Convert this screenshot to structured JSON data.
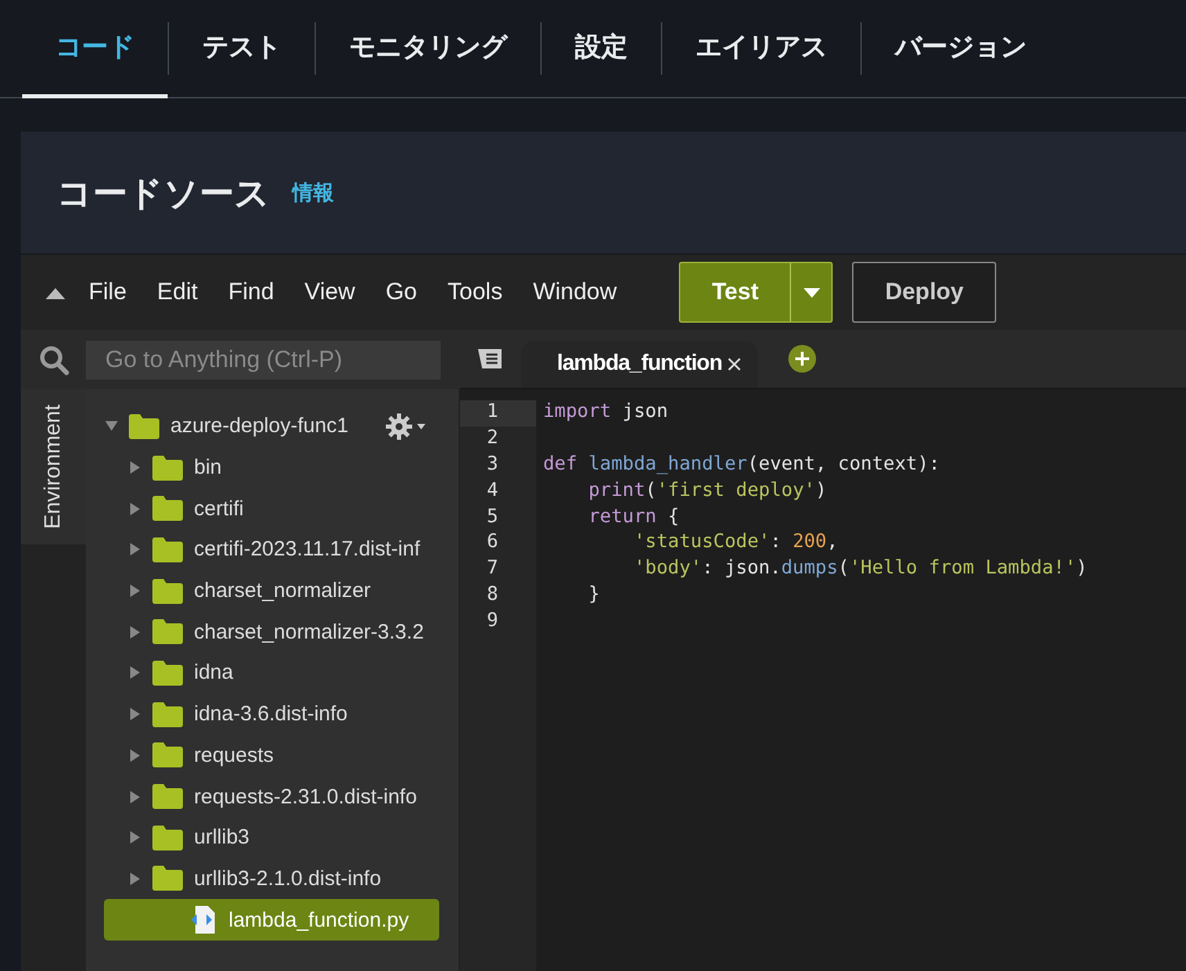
{
  "tabs": [
    {
      "label": "コード",
      "selected": true
    },
    {
      "label": "テスト",
      "selected": false
    },
    {
      "label": "モニタリング",
      "selected": false
    },
    {
      "label": "設定",
      "selected": false
    },
    {
      "label": "エイリアス",
      "selected": false
    },
    {
      "label": "バージョン",
      "selected": false
    }
  ],
  "section": {
    "title": "コードソース",
    "info_link": "情報"
  },
  "ide": {
    "menu": [
      "File",
      "Edit",
      "Find",
      "View",
      "Go",
      "Tools",
      "Window"
    ],
    "test_button": "Test",
    "deploy_button": "Deploy",
    "search": {
      "placeholder": "Go to Anything (Ctrl-P)"
    },
    "side_tab": "Environment",
    "tree": [
      {
        "name": "azure-deploy-func1",
        "kind": "folder",
        "expanded": true,
        "selected": false,
        "children": [
          {
            "name": "bin",
            "kind": "folder",
            "expanded": false,
            "selected": false
          },
          {
            "name": "certifi",
            "kind": "folder",
            "expanded": false,
            "selected": false
          },
          {
            "name": "certifi-2023.11.17.dist-inf",
            "kind": "folder",
            "expanded": false,
            "selected": false
          },
          {
            "name": "charset_normalizer",
            "kind": "folder",
            "expanded": false,
            "selected": false
          },
          {
            "name": "charset_normalizer-3.3.2",
            "kind": "folder",
            "expanded": false,
            "selected": false
          },
          {
            "name": "idna",
            "kind": "folder",
            "expanded": false,
            "selected": false
          },
          {
            "name": "idna-3.6.dist-info",
            "kind": "folder",
            "expanded": false,
            "selected": false
          },
          {
            "name": "requests",
            "kind": "folder",
            "expanded": false,
            "selected": false
          },
          {
            "name": "requests-2.31.0.dist-info",
            "kind": "folder",
            "expanded": false,
            "selected": false
          },
          {
            "name": "urllib3",
            "kind": "folder",
            "expanded": false,
            "selected": false
          },
          {
            "name": "urllib3-2.1.0.dist-info",
            "kind": "folder",
            "expanded": false,
            "selected": false
          },
          {
            "name": "lambda_function.py",
            "kind": "file",
            "selected": true
          }
        ]
      }
    ],
    "editor_tabs": [
      {
        "label": "lambda_function",
        "selected": true
      }
    ],
    "code": [
      {
        "number": "1",
        "tokens": [
          {
            "kind": "keyword",
            "text": "import"
          },
          {
            "kind": "plain",
            "text": " json"
          }
        ]
      },
      {
        "number": "2"
      },
      {
        "number": "3",
        "tokens": [
          {
            "kind": "keyword",
            "text": "def "
          },
          {
            "kind": "function",
            "text": "lambda_handler"
          },
          {
            "kind": "plain",
            "text": "(event, context):"
          }
        ]
      },
      {
        "number": "4",
        "tokens": [
          {
            "kind": "keyword",
            "text": "    print"
          },
          {
            "kind": "plain",
            "text": "("
          },
          {
            "kind": "string",
            "text": "'first deploy'"
          },
          {
            "kind": "plain",
            "text": ")"
          }
        ]
      },
      {
        "number": "5",
        "tokens": [
          {
            "kind": "keyword",
            "text": "    return"
          },
          {
            "kind": "plain",
            "text": " {"
          }
        ]
      },
      {
        "number": "6",
        "tokens": [
          {
            "kind": "string",
            "text": "        'statusCode'"
          },
          {
            "kind": "plain",
            "text": ": "
          },
          {
            "kind": "number",
            "text": "200"
          },
          {
            "kind": "plain",
            "text": ","
          }
        ]
      },
      {
        "number": "7",
        "tokens": [
          {
            "kind": "string",
            "text": "        'body'"
          },
          {
            "kind": "plain",
            "text": ": json."
          },
          {
            "kind": "function",
            "text": "dumps"
          },
          {
            "kind": "plain",
            "text": "("
          },
          {
            "kind": "string",
            "text": "'Hello from Lambda!'"
          },
          {
            "kind": "plain",
            "text": ")"
          }
        ]
      },
      {
        "number": "8",
        "tokens": [
          {
            "kind": "plain",
            "text": "    }"
          }
        ]
      },
      {
        "number": "9"
      }
    ]
  }
}
